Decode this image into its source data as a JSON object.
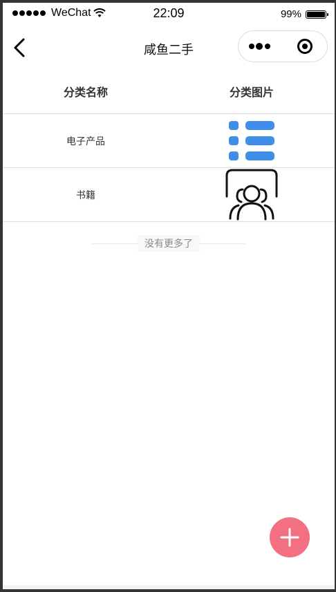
{
  "status_bar": {
    "carrier": "WeChat",
    "time": "22:09",
    "battery": "99%"
  },
  "nav": {
    "title": "咸鱼二手"
  },
  "table": {
    "headers": [
      "分类名称",
      "分类图片"
    ],
    "rows": [
      {
        "name": "电子产品",
        "image_icon": "list-icon",
        "color": "#3f8ee8"
      },
      {
        "name": "书籍",
        "image_icon": "group-users-icon",
        "color": "#111111"
      }
    ]
  },
  "footer": {
    "no_more": "没有更多了"
  },
  "fab": {
    "icon": "plus-icon",
    "color": "#f27082"
  }
}
